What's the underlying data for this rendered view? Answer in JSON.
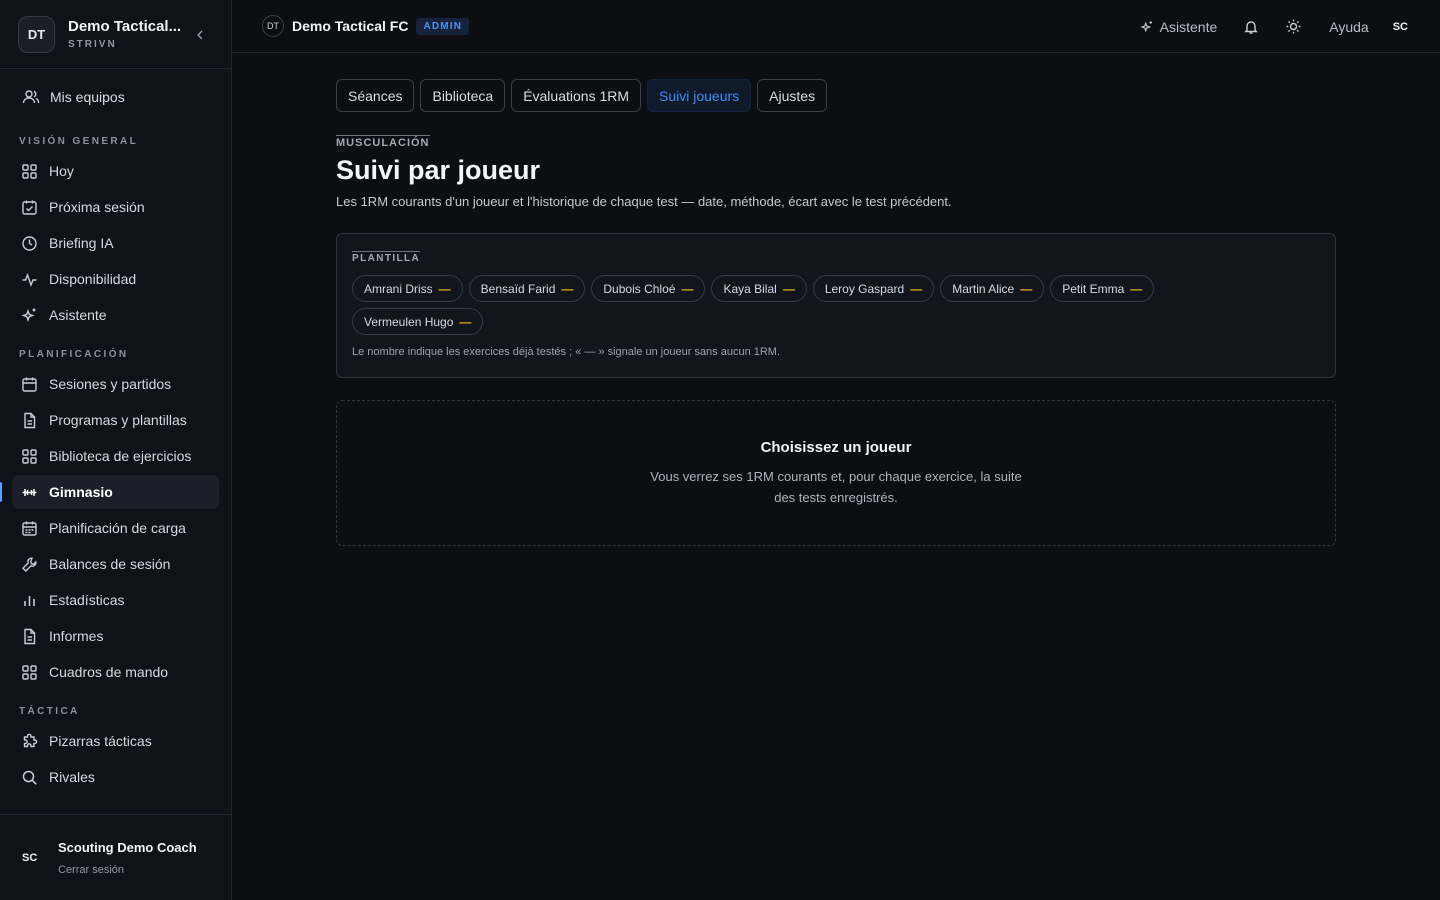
{
  "brand": {
    "initials": "DT",
    "name": "Demo Tactical...",
    "subtitle": "STRIVN"
  },
  "sidebar": {
    "teams_label": "Mis equipos",
    "sections": [
      {
        "label": "VISIÓN GENERAL",
        "items": [
          {
            "label": "Hoy",
            "icon": "grid-icon"
          },
          {
            "label": "Próxima sesión",
            "icon": "calendar-check-icon"
          },
          {
            "label": "Briefing IA",
            "icon": "clock-icon"
          },
          {
            "label": "Disponibilidad",
            "icon": "activity-icon"
          },
          {
            "label": "Asistente",
            "icon": "sparkles-icon"
          }
        ]
      },
      {
        "label": "PLANIFICACIÓN",
        "items": [
          {
            "label": "Sesiones y partidos",
            "icon": "calendar-icon"
          },
          {
            "label": "Programas y plantillas",
            "icon": "document-icon"
          },
          {
            "label": "Biblioteca de ejercicios",
            "icon": "grid-icon"
          },
          {
            "label": "Gimnasio",
            "icon": "dumbbell-icon",
            "active": true
          },
          {
            "label": "Planificación de carga",
            "icon": "calendar-grid-icon"
          },
          {
            "label": "Balances de sesión",
            "icon": "wrench-icon"
          },
          {
            "label": "Estadísticas",
            "icon": "bar-chart-icon"
          },
          {
            "label": "Informes",
            "icon": "document-icon"
          },
          {
            "label": "Cuadros de mando",
            "icon": "grid-icon"
          }
        ]
      },
      {
        "label": "TÁCTICA",
        "items": [
          {
            "label": "Pizarras tácticas",
            "icon": "puzzle-icon"
          },
          {
            "label": "Rivales",
            "icon": "search-icon"
          }
        ]
      }
    ],
    "user": {
      "initials": "SC",
      "name": "Scouting Demo Coach",
      "logout": "Cerrar sesión"
    }
  },
  "topbar": {
    "org_initials": "DT",
    "org_name": "Demo Tactical FC",
    "role_badge": "ADMIN",
    "assistant_label": "Asistente",
    "help_label": "Ayuda",
    "user_initials": "SC"
  },
  "tabs": [
    {
      "label": "Séances"
    },
    {
      "label": "Biblioteca"
    },
    {
      "label": "Évaluations 1RM"
    },
    {
      "label": "Suivi joueurs",
      "active": true
    },
    {
      "label": "Ajustes"
    }
  ],
  "page": {
    "eyebrow": "MUSCULACIÓN",
    "title": "Suivi par joueur",
    "description": "Les 1RM courants d'un joueur et l'historique de chaque test — date, méthode, écart avec le test précédent."
  },
  "roster": {
    "label": "PLANTILLA",
    "players": [
      {
        "name": "Amrani Driss",
        "count": "—"
      },
      {
        "name": "Bensaïd Farid",
        "count": "—"
      },
      {
        "name": "Dubois Chloé",
        "count": "—"
      },
      {
        "name": "Kaya Bilal",
        "count": "—"
      },
      {
        "name": "Leroy Gaspard",
        "count": "—"
      },
      {
        "name": "Martin Alice",
        "count": "—"
      },
      {
        "name": "Petit Emma",
        "count": "—"
      },
      {
        "name": "Vermeulen Hugo",
        "count": "—"
      }
    ],
    "note": "Le nombre indique les exercices déjà testés ; « — » signale un joueur sans aucun 1RM."
  },
  "empty_state": {
    "title": "Choisissez un joueur",
    "text": "Vous verrez ses 1RM courants et, pour chaque exercice, la suite des tests enregistrés."
  },
  "colors": {
    "accent": "#3d8cf5",
    "dash": "#e6b422",
    "background": "#0c0e14"
  }
}
